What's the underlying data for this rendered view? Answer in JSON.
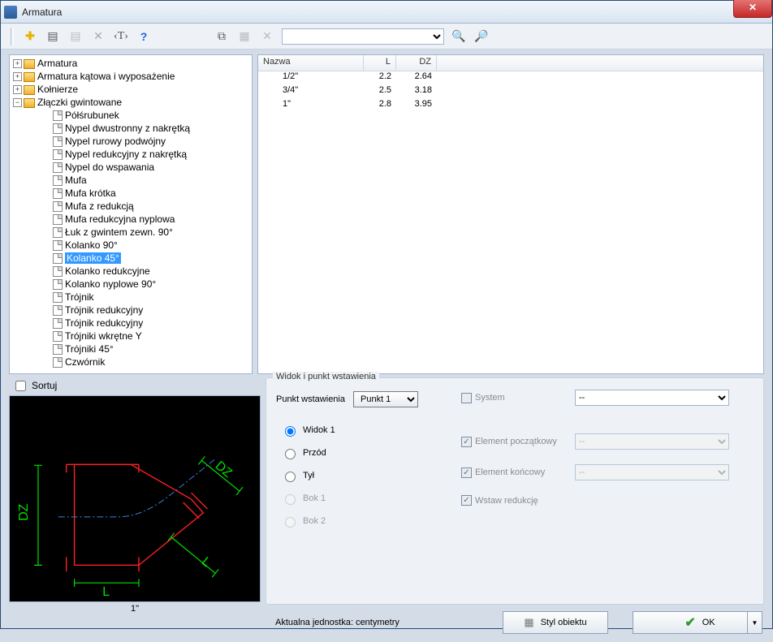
{
  "window": {
    "title": "Armatura"
  },
  "toolbar": {
    "search_value": ""
  },
  "tree": {
    "top": [
      {
        "label": "Armatura",
        "expand": "+"
      },
      {
        "label": "Armatura kątowa i wyposażenie",
        "expand": "+"
      },
      {
        "label": "Kołnierze",
        "expand": "+"
      },
      {
        "label": "Złączki gwintowane",
        "expand": "−"
      }
    ],
    "children": [
      "Półśrubunek",
      "Nypel dwustronny z nakrętką",
      "Nypel rurowy podwójny",
      "Nypel redukcyjny z nakrętką",
      "Nypel do wspawania",
      "Mufa",
      "Mufa krótka",
      "Mufa z redukcją",
      "Mufa redukcyjna nyplowa",
      "Łuk z gwintem zewn. 90°",
      "Kolanko 90°",
      "Kolanko 45°",
      "Kolanko redukcyjne",
      "Kolanko nyplowe 90°",
      "Trójnik",
      "Trójnik redukcyjny",
      "Trójnik redukcyjny",
      "Trójniki wkrętne Y",
      "Trójniki 45°",
      "Czwórnik"
    ],
    "selected_index": 11
  },
  "list": {
    "columns": {
      "name": "Nazwa",
      "l": "L",
      "dz": "DZ"
    },
    "rows": [
      {
        "name": "1/2\"",
        "l": "2.2",
        "dz": "2.64"
      },
      {
        "name": "3/4\"",
        "l": "2.5",
        "dz": "3.18"
      },
      {
        "name": "1\"",
        "l": "2.8",
        "dz": "3.95"
      }
    ]
  },
  "sort_label": "Sortuj",
  "preview_label": "1\"",
  "group": {
    "legend": "Widok i punkt wstawienia",
    "insertion_label": "Punkt wstawienia",
    "insertion_value": "Punkt 1",
    "views": {
      "widok1": "Widok 1",
      "przod": "Przód",
      "tyl": "Tył",
      "bok1": "Bok 1",
      "bok2": "Bok 2"
    },
    "system_label": "System",
    "system_value": "--",
    "elem_start": "Element początkowy",
    "elem_start_value": "--",
    "elem_end": "Element końcowy",
    "elem_end_value": "--",
    "insert_reduction": "Wstaw redukcję"
  },
  "unit_label": "Aktualna jednostka: centymetry",
  "style_button": "Styl obiektu",
  "ok_button": "OK"
}
